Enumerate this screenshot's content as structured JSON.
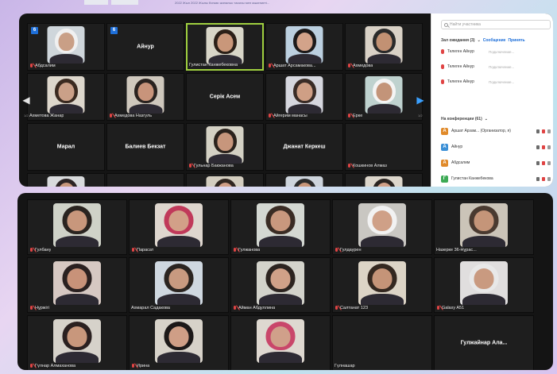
{
  "top_caption": "2022 Жыл 2022 Жылы Күнкөр жиналыс тарихы мен мәдениеті...",
  "panel1": {
    "tiles": [
      {
        "name": "Абдсалим",
        "muted": true,
        "badge": "6",
        "video": true,
        "skin": "#c99f86",
        "bg": "#cfd6db",
        "hair": "#f0f0f0"
      },
      {
        "name": "Айнур",
        "muted": false,
        "badge": "6",
        "video": false,
        "center": true
      },
      {
        "name": "Гулистан Канжебековна",
        "muted": false,
        "video": true,
        "active": true,
        "skin": "#c9977a",
        "bg": "#d8d6c8",
        "hair": "#2b2018"
      },
      {
        "name": "Аршат Арсамакова...",
        "muted": true,
        "video": true,
        "skin": "#d3a38a",
        "bg": "#bcd0e0",
        "hair": "#1d1a1a"
      },
      {
        "name": "Ахмедова",
        "muted": true,
        "video": true,
        "skin": "#c29173",
        "bg": "#d9d1c6",
        "hair": "#2a2a2a"
      },
      {
        "name": "Ахметова Жанар",
        "muted": false,
        "video": true,
        "skin": "#caa088",
        "bg": "#ddd7cc",
        "hair": "#3a2a20"
      },
      {
        "name": "Ахмедова Назгуль",
        "muted": true,
        "video": true,
        "skin": "#c8947b",
        "bg": "#cfc8bd",
        "hair": "#2a2320"
      },
      {
        "name": "Серік Асем",
        "muted": false,
        "video": false,
        "center": true
      },
      {
        "name": "Айгерим манасы",
        "muted": true,
        "video": true,
        "skin": "#cf9f85",
        "bg": "#d6d7de",
        "hair": "#3a2c26"
      },
      {
        "name": "Ерке",
        "muted": true,
        "video": true,
        "skin": "#c39479",
        "bg": "#bfd2cf",
        "hair": "#f4f4f4"
      },
      {
        "name": "Марал",
        "muted": false,
        "video": false,
        "center": true
      },
      {
        "name": "Балиев Бекзат",
        "muted": false,
        "video": false,
        "center": true
      },
      {
        "name": "Гульнар Бакжанова",
        "muted": true,
        "video": true,
        "skin": "#c7967c",
        "bg": "#d4d1c4",
        "hair": "#2a221c"
      },
      {
        "name": "Джанат Керкеш",
        "muted": false,
        "video": false,
        "center": true
      },
      {
        "name": "Кошкинов Алмаз",
        "muted": true,
        "video": false,
        "center": false
      },
      {
        "name": "",
        "muted": false,
        "video": true,
        "skin": "#c9987d",
        "bg": "#d8dadc",
        "hair": "#2c2424"
      },
      {
        "name": "",
        "muted": false,
        "video": false
      },
      {
        "name": "",
        "muted": true,
        "video": true,
        "skin": "#cf9e86",
        "bg": "#d3cdbf",
        "hair": "#302620"
      },
      {
        "name": "",
        "muted": false,
        "video": true,
        "skin": "#c8967a",
        "bg": "#cdd4dc",
        "hair": "#2b2b2b"
      },
      {
        "name": "",
        "muted": true,
        "video": true,
        "skin": "#d1a188",
        "bg": "#dcd6cb",
        "hair": "#2a2420"
      }
    ],
    "page_left": "1/2",
    "page_right": "1/2"
  },
  "sidebar": {
    "search_placeholder": "Найти участника",
    "waiting_label": "Зал ожидания (3)",
    "waiting_chevron": "⌄",
    "message_link": "Сообщение",
    "admit_link": "Принять",
    "waiting": [
      {
        "name": "Телеген Айнур",
        "status": "Подключение..."
      },
      {
        "name": "Телеген Айнур",
        "status": "Подключение..."
      },
      {
        "name": "Телеген Айнур",
        "status": "Подключение..."
      }
    ],
    "conference_label": "На конференции (61)",
    "participants": [
      {
        "initial": "А",
        "name": "Аршат Арзам... (Организатор, я)",
        "color": "#e08a2a"
      },
      {
        "initial": "А",
        "name": "Айнур",
        "color": "#3a8fd6"
      },
      {
        "initial": "А",
        "name": "Абдсалим",
        "color": "#e08a2a"
      },
      {
        "initial": "Г",
        "name": "Гулистан Канжебекова",
        "color": "#3daa55"
      }
    ]
  },
  "panel2": {
    "tiles": [
      {
        "name": "Гулбану",
        "muted": true,
        "video": true,
        "skin": "#c8977c",
        "bg": "#cfd2c8",
        "hair": "#2a2420"
      },
      {
        "name": "Парасат",
        "muted": true,
        "video": true,
        "skin": "#d2a088",
        "bg": "#ded6ce",
        "hair": "#c0395a"
      },
      {
        "name": "Гулжанова",
        "muted": true,
        "video": true,
        "skin": "#c9987e",
        "bg": "#d4d8d2",
        "hair": "#3a2c24"
      },
      {
        "name": "Гулдаурен",
        "muted": true,
        "video": true,
        "skin": "#cfa087",
        "bg": "#c9c7c2",
        "hair": "#f2f2f2"
      },
      {
        "name": "Назерке 36-Нұрас...",
        "muted": false,
        "video": true,
        "skin": "#c59579",
        "bg": "#cbc4b8",
        "hair": "#4a3a30"
      },
      {
        "name": "Нұржігі",
        "muted": true,
        "video": true,
        "skin": "#c89279",
        "bg": "#d6c8c2",
        "hair": "#2a2020"
      },
      {
        "name": "Ахмарал Садакова",
        "muted": false,
        "video": true,
        "skin": "#c89a80",
        "bg": "#cfd8e0",
        "hair": "#2a2420"
      },
      {
        "name": "Айман Абдуллина",
        "muted": true,
        "video": true,
        "skin": "#d0a188",
        "bg": "#d3d3cb",
        "hair": "#2c2420"
      },
      {
        "name": "Салтанат 123",
        "muted": true,
        "video": true,
        "skin": "#c59478",
        "bg": "#dcd4c6",
        "hair": "#342820"
      },
      {
        "name": "Galaxy A51",
        "muted": true,
        "video": true,
        "skin": "#c99a80",
        "bg": "#e0dede",
        "hair": "#e8e8e8"
      },
      {
        "name": "Гүлнар Алмаханова",
        "muted": true,
        "video": true,
        "skin": "#c8977c",
        "bg": "#d6d2ca",
        "hair": "#2a2020"
      },
      {
        "name": "Ирина",
        "muted": true,
        "video": true,
        "skin": "#cf9e86",
        "bg": "#d7d2c9",
        "hair": "#1c1818"
      },
      {
        "name": "",
        "muted": false,
        "video": true,
        "skin": "#d0a08a",
        "bg": "#ded8d0",
        "hair": "#c9466a"
      },
      {
        "name": "Гүлнашар",
        "muted": false,
        "video": false
      },
      {
        "name": "Гулжайнар Ала...",
        "muted": false,
        "video": false,
        "center": true
      }
    ]
  },
  "colors": {
    "panel_bg": "#141414",
    "tile_bg": "#1e1e1e",
    "active_border": "#9fcf3f",
    "badge_blue": "#1e6fd9",
    "muted_red": "#e04444",
    "link_blue": "#1e6fd9"
  }
}
